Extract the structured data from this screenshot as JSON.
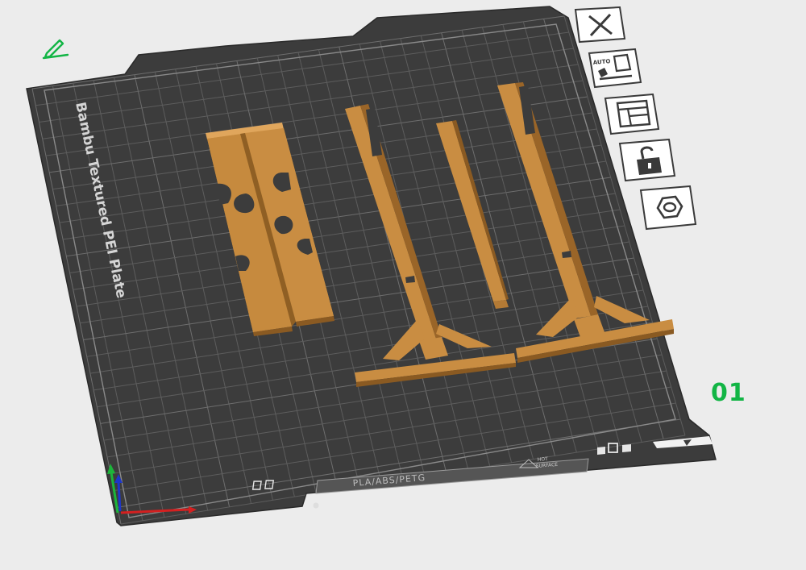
{
  "plate": {
    "brand_label": "Bambu Textured PEI Plate",
    "material_label": "PLA/ABS/PETG",
    "hot_surface_line1": "HOT",
    "hot_surface_line2": "SURFACE",
    "plate_number": "01"
  },
  "toolbar": {
    "auto_label": "AUTO"
  },
  "colors": {
    "plate": "#3c3c3c",
    "grid": "#5a5a5a",
    "model": "#c78a3e",
    "accent_green": "#12b545",
    "axis_x": "#d42020",
    "axis_y": "#1cb53a",
    "axis_z": "#1d36c9"
  },
  "icons": {
    "edit": "pencil-icon",
    "close": "close-icon",
    "auto_arrange": "auto-arrange-icon",
    "layout": "layout-icon",
    "lock": "lock-open-icon",
    "settings": "hexagon-nut-icon"
  }
}
